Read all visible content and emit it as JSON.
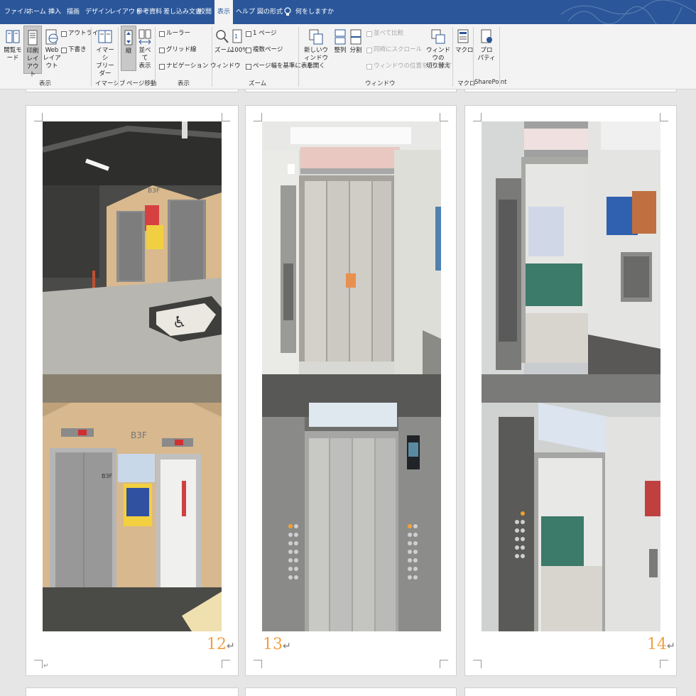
{
  "menu": {
    "tabs": [
      "ファイル",
      "ホーム",
      "挿入",
      "描画",
      "デザイン",
      "レイアウト",
      "参考資料",
      "差し込み文書",
      "校閲",
      "表示",
      "ヘルプ",
      "図の形式"
    ],
    "active_tab": "表示",
    "tell_me": "何をしますか"
  },
  "ribbon": {
    "read_mode": "閲覧モード",
    "print_layout": "印刷\nレイアウト",
    "web_layout": "Web\nレイアウト",
    "outline": "アウトライン",
    "draft": "下書き",
    "immersive_reader": "イマーシ\nブリーダー",
    "vertical": "縦",
    "side_by_side": "並べて\n表示",
    "ruler": "ルーラー",
    "gridlines": "グリッド線",
    "nav_pane": "ナビゲーション ウィンドウ",
    "zoom": "ズーム",
    "zoom100": "100%",
    "one_page": "1 ページ",
    "multi_page": "複数ページ",
    "page_width": "ページ幅を基準に表示",
    "new_window": "新しいウィンドウ\nを開く",
    "arrange_all": "整列",
    "split": "分割",
    "side_compare": "並べて比較",
    "sync_scroll": "同時にスクロール",
    "reset_position": "ウィンドウの位置を元に戻す",
    "switch_windows": "ウィンドウの\n切り替え",
    "macro": "マクロ",
    "properties": "プロ\nパティ",
    "groups": {
      "views": "表示",
      "immersive": "イマーシブ",
      "page_movement": "ページ移動",
      "show": "表示",
      "zoom": "ズーム",
      "window": "ウィンドウ",
      "macros": "マクロ",
      "sharepoint": "SharePoint"
    }
  },
  "pages": [
    {
      "number": "12",
      "return_mark": "↵"
    },
    {
      "number": "13",
      "return_mark": "↵"
    },
    {
      "number": "14",
      "return_mark": "↵"
    }
  ],
  "para_mark": "↵",
  "photos": {
    "b3f_sign": "B3F",
    "b3f_door": "B3F"
  },
  "colors": {
    "title_bar": "#2b579a",
    "ribbon_bg": "#f3f3f3",
    "page_number": "#f0a040"
  }
}
